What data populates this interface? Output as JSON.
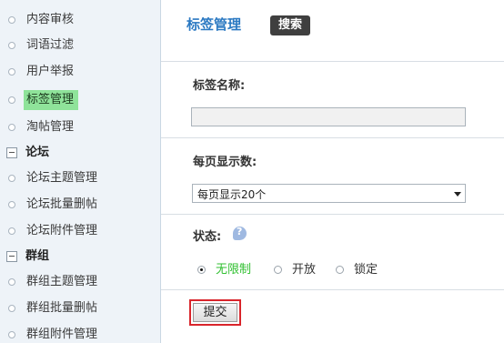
{
  "sidebar": {
    "items": [
      {
        "label": "内容审核"
      },
      {
        "label": "词语过滤"
      },
      {
        "label": "用户举报"
      },
      {
        "label": "标签管理"
      },
      {
        "label": "淘帖管理"
      },
      {
        "label": "论坛主题管理"
      },
      {
        "label": "论坛批量删帖"
      },
      {
        "label": "论坛附件管理"
      },
      {
        "label": "群组主题管理"
      },
      {
        "label": "群组批量删帖"
      },
      {
        "label": "群组附件管理"
      }
    ],
    "groups": [
      {
        "label": "论坛"
      },
      {
        "label": "群组"
      }
    ],
    "active_item": "标签管理"
  },
  "main": {
    "title": "标签管理",
    "search_label": "搜索",
    "tag_name_label": "标签名称:",
    "tag_name_value": "",
    "per_page_label": "每页显示数:",
    "per_page_selected": "每页显示20个",
    "status_label": "状态:",
    "status_options": [
      {
        "label": "无限制",
        "checked": true
      },
      {
        "label": "开放",
        "checked": false
      },
      {
        "label": "锁定",
        "checked": false
      }
    ],
    "submit_label": "提交"
  },
  "colors": {
    "accent": "#2b79c2",
    "active_highlight": "#8fe39a",
    "checked_text": "#2fbf2f",
    "submit_border": "#d9252b"
  }
}
